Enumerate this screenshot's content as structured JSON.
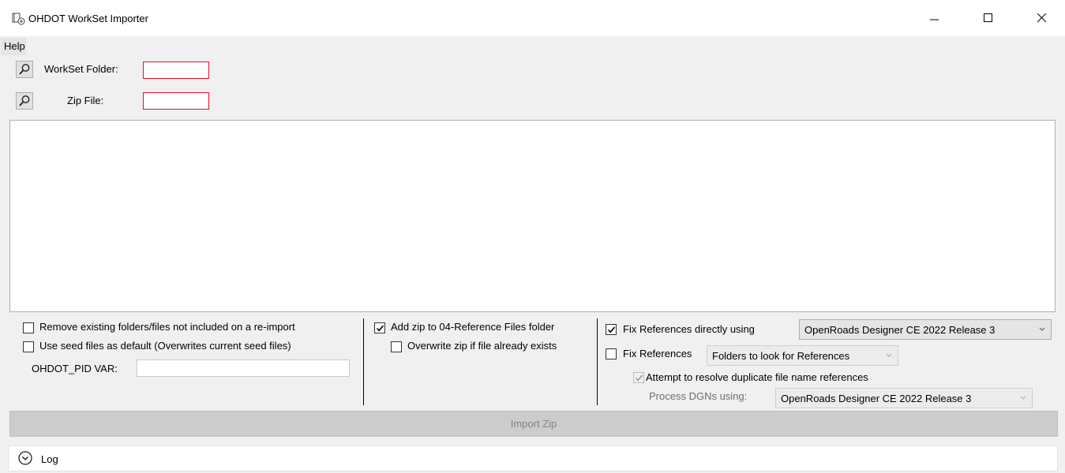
{
  "window": {
    "title": "OHDOT WorkSet Importer"
  },
  "menu": {
    "help": "Help"
  },
  "fields": {
    "workset_label": "WorkSet Folder:",
    "zip_label": "Zip File:",
    "workset_value": "",
    "zip_value": ""
  },
  "options": {
    "remove_existing": {
      "label": "Remove existing folders/files not included on a re-import",
      "checked": false
    },
    "use_seed": {
      "label": "Use seed files as default (Overwrites current seed files)",
      "checked": false
    },
    "pid_label": "OHDOT_PID VAR:",
    "pid_value": "",
    "add_zip": {
      "label": "Add zip to 04-Reference Files folder",
      "checked": true
    },
    "overwrite_zip": {
      "label": "Overwrite zip if file already exists",
      "checked": false
    },
    "fix_direct": {
      "label": "Fix References directly using",
      "checked": true
    },
    "fix_direct_combo": "OpenRoads Designer CE 2022 Release 3",
    "fix_folders": {
      "label": "Fix References",
      "checked": false
    },
    "fix_folders_combo": "Folders to look for References",
    "resolve_dup": {
      "label": "Attempt to resolve duplicate file name references",
      "checked": true
    },
    "process_label": "Process DGNs using:",
    "process_combo": "OpenRoads Designer CE 2022 Release 3"
  },
  "actions": {
    "import_label": "Import Zip"
  },
  "log": {
    "label": "Log"
  },
  "colors": {
    "error_border": "#e81123",
    "disabled_text": "#838383"
  }
}
